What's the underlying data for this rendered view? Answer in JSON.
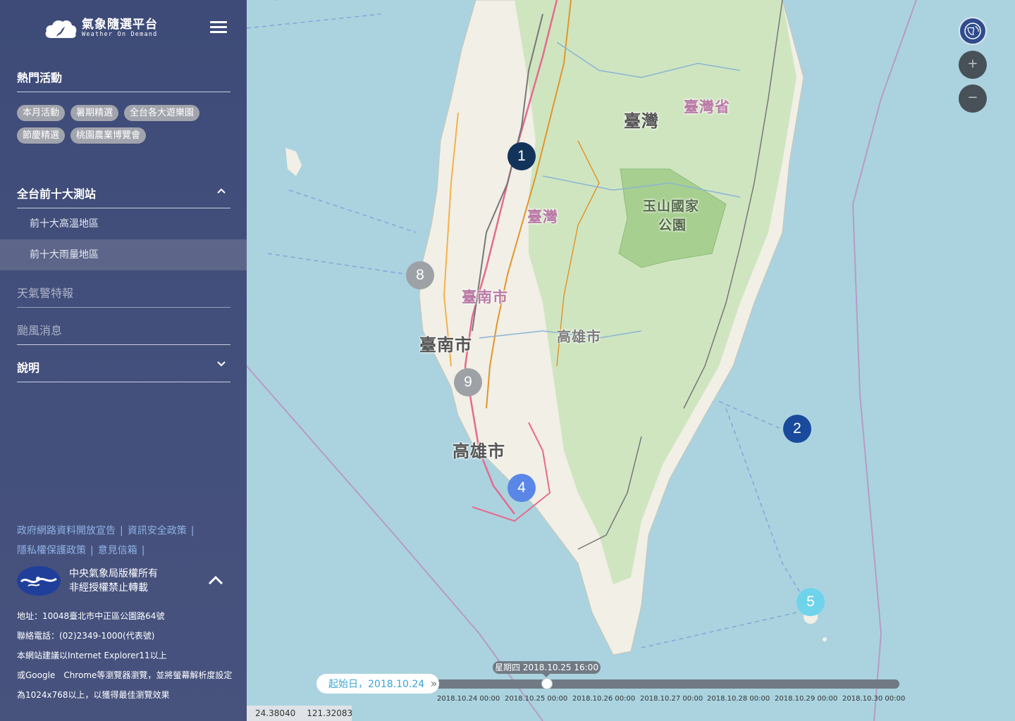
{
  "brand": {
    "name_zh": "氣象隨選平台",
    "name_en": "Weather On Demand"
  },
  "sidebar": {
    "hot_events": {
      "title": "熱門活動",
      "tags": [
        "本月活動",
        "暑期精選",
        "全台各大遊樂園",
        "節慶精選",
        "桃園農業博覽會"
      ]
    },
    "top10": {
      "title": "全台前十大測站",
      "items": [
        "前十大高溫地區",
        "前十大雨量地區"
      ]
    },
    "warnings": "天氣警特報",
    "typhoon": "颱風消息",
    "help": "說明"
  },
  "footer": {
    "links": [
      "政府網路資料開放宣告",
      "資訊安全政策",
      "隱私權保護政策",
      "意見信箱"
    ],
    "copyright_line1": "中央氣象局版權所有",
    "copyright_line2": "非經授權禁止轉載",
    "address": "地址：10048臺北市中正區公園路64號",
    "phone": "聯絡電話：(02)2349-1000(代表號)",
    "browser_line1": "本網站建議以Internet Explorer11以上",
    "browser_line2": "或Google　Chrome等瀏覽器瀏覽，並將螢幕解析度設定",
    "browser_line3": "為1024x768以上，以獲得最佳瀏覽效果"
  },
  "map": {
    "labels": {
      "taiwan_big": "臺灣",
      "taiwan_province": "臺灣省",
      "taiwan_pink": "臺灣",
      "yushan": "玉山國家",
      "yushan2": "公園",
      "tainan_pink": "臺南市",
      "tainan": "臺南市",
      "kaohsiung_pink": "高雄市",
      "kaohsiung": "高雄市"
    },
    "markers": [
      {
        "label": "1",
        "color": "#13345a"
      },
      {
        "label": "2",
        "color": "#1a4a9c"
      },
      {
        "label": "4",
        "color": "#5a86e6"
      },
      {
        "label": "5",
        "color": "#6fd3ec"
      },
      {
        "label": "8",
        "color": "#9ea1a6"
      },
      {
        "label": "9",
        "color": "#9ea1a6"
      }
    ],
    "controls": {
      "zoom_in": "+",
      "zoom_out": "−"
    }
  },
  "timeline": {
    "start_label": "起始日，2018.10.24",
    "start_arrow": "»",
    "current": "星期四 2018.10.25 16:00",
    "ticks": [
      "2018.10.24 00:00",
      "2018.10.25 00:00",
      "2018.10.26 00:00",
      "2018.10.27 00:00",
      "2018.10.28 00:00",
      "2018.10.29 00:00",
      "2018.10.30 00:00"
    ]
  },
  "coords": {
    "lat": "24.38040",
    "lon": "121.32083"
  }
}
